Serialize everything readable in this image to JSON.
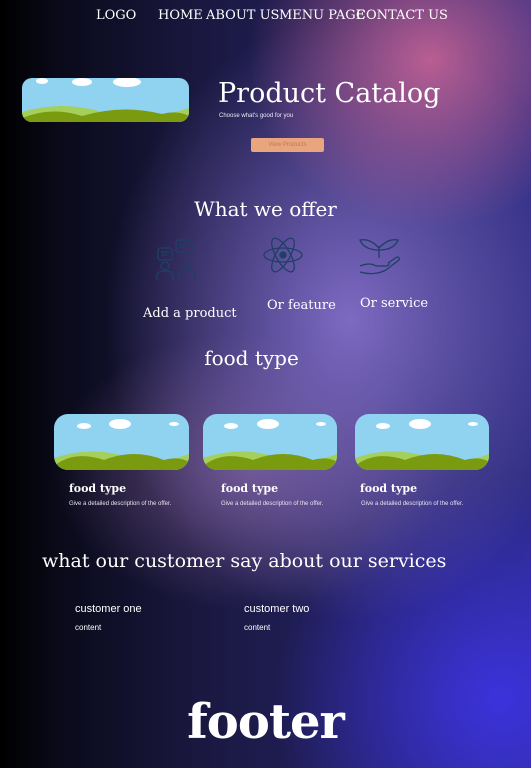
{
  "nav": {
    "logo": "LOGO",
    "links": [
      "HOME",
      "ABOUT US",
      "MENU PAGE",
      "CONTACT US"
    ]
  },
  "hero": {
    "title": "Product Catalog",
    "subtitle": "Choose what's good for you",
    "button_label": "View Products"
  },
  "offer": {
    "heading": "What we offer",
    "items": [
      {
        "icon": "people-chat-icon",
        "label": "Add a product"
      },
      {
        "icon": "atom-icon",
        "label": "Or feature"
      },
      {
        "icon": "hand-plant-icon",
        "label": "Or service"
      }
    ]
  },
  "food": {
    "heading": "food type",
    "cards": [
      {
        "title": "food type",
        "desc": "Give a detailed description of the offer."
      },
      {
        "title": "food type",
        "desc": "Give a detailed description of the offer."
      },
      {
        "title": "food type",
        "desc": "Give a detailed description of the offer."
      }
    ]
  },
  "testimonials": {
    "heading": "what our customer say about our services",
    "items": [
      {
        "name": "customer one",
        "content": "content"
      },
      {
        "name": "customer two",
        "content": "content"
      }
    ]
  },
  "footer": {
    "label": "footer"
  },
  "colors": {
    "button_bg": "#e8a57e",
    "icon_stroke": "#1f3f66",
    "grass": "#7a9a10",
    "sky": "#8fd3f0"
  }
}
